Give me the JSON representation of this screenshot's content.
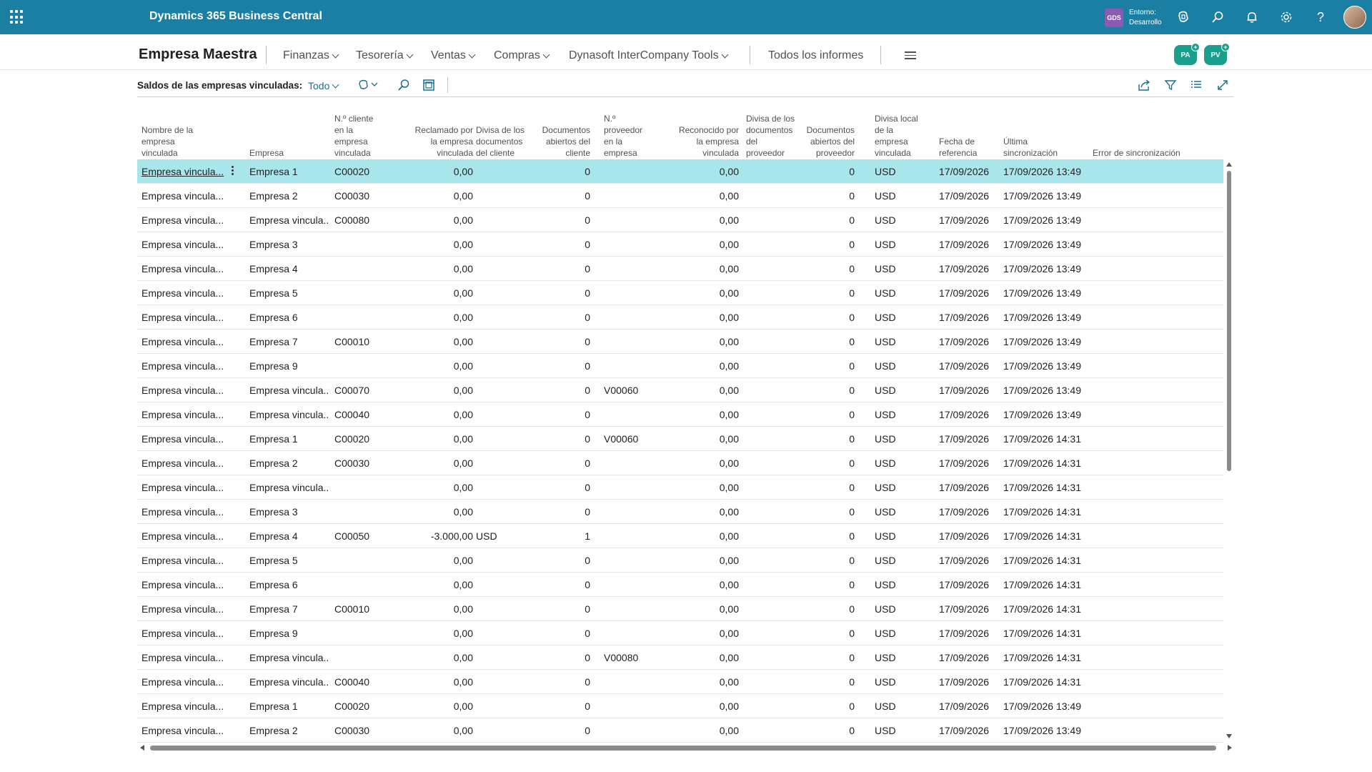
{
  "app": {
    "title": "Dynamics 365 Business Central"
  },
  "environment": {
    "badge": "GDS",
    "label": "Entorno:",
    "value": "Desarrollo"
  },
  "nav": {
    "company": "Empresa Maestra",
    "items": [
      {
        "label": "Finanzas"
      },
      {
        "label": "Tesorería"
      },
      {
        "label": "Ventas"
      },
      {
        "label": "Compras"
      },
      {
        "label": "Dynasoft InterCompany Tools"
      }
    ],
    "reports": "Todos los informes",
    "copilots": [
      {
        "label": "PA"
      },
      {
        "label": "PV"
      }
    ]
  },
  "part": {
    "title": "Saldos de las empresas vinculadas:",
    "filter": "Todo"
  },
  "columns": [
    [
      "Nombre de la",
      "empresa",
      "vinculada"
    ],
    [
      "Empresa"
    ],
    [
      "N.º cliente",
      "en la",
      "empresa",
      "vinculada"
    ],
    [
      "Reclamado por",
      "la empresa",
      "vinculada"
    ],
    [
      "Divisa de los",
      "documentos",
      "del cliente"
    ],
    [
      "Documentos",
      "abiertos del",
      "cliente"
    ],
    [
      "N.º",
      "proveedor",
      "en la",
      "empresa"
    ],
    [
      "Reconocido por",
      "la empresa",
      "vinculada"
    ],
    [
      "Divisa de los",
      "documentos",
      "del",
      "proveedor"
    ],
    [
      "Documentos",
      "abiertos del",
      "proveedor"
    ],
    [
      "Divisa local",
      "de la",
      "empresa",
      "vinculada"
    ],
    [
      "Fecha de",
      "referencia"
    ],
    [
      "Última",
      "sincronización"
    ],
    [
      "Error de sincronización"
    ]
  ],
  "rows": [
    [
      "Empresa vincula...",
      "Empresa 1",
      "C00020",
      "0,00",
      "",
      "0",
      "",
      "0,00",
      "",
      "0",
      "USD",
      "17/09/2026",
      "17/09/2026 13:49",
      ""
    ],
    [
      "Empresa vincula...",
      "Empresa 2",
      "C00030",
      "0,00",
      "",
      "0",
      "",
      "0,00",
      "",
      "0",
      "USD",
      "17/09/2026",
      "17/09/2026 13:49",
      ""
    ],
    [
      "Empresa vincula...",
      "Empresa vincula...",
      "C00080",
      "0,00",
      "",
      "0",
      "",
      "0,00",
      "",
      "0",
      "USD",
      "17/09/2026",
      "17/09/2026 13:49",
      ""
    ],
    [
      "Empresa vincula...",
      "Empresa 3",
      "",
      "0,00",
      "",
      "0",
      "",
      "0,00",
      "",
      "0",
      "USD",
      "17/09/2026",
      "17/09/2026 13:49",
      ""
    ],
    [
      "Empresa vincula...",
      "Empresa 4",
      "",
      "0,00",
      "",
      "0",
      "",
      "0,00",
      "",
      "0",
      "USD",
      "17/09/2026",
      "17/09/2026 13:49",
      ""
    ],
    [
      "Empresa vincula...",
      "Empresa 5",
      "",
      "0,00",
      "",
      "0",
      "",
      "0,00",
      "",
      "0",
      "USD",
      "17/09/2026",
      "17/09/2026 13:49",
      ""
    ],
    [
      "Empresa vincula...",
      "Empresa 6",
      "",
      "0,00",
      "",
      "0",
      "",
      "0,00",
      "",
      "0",
      "USD",
      "17/09/2026",
      "17/09/2026 13:49",
      ""
    ],
    [
      "Empresa vincula...",
      "Empresa 7",
      "C00010",
      "0,00",
      "",
      "0",
      "",
      "0,00",
      "",
      "0",
      "USD",
      "17/09/2026",
      "17/09/2026 13:49",
      ""
    ],
    [
      "Empresa vincula...",
      "Empresa 9",
      "",
      "0,00",
      "",
      "0",
      "",
      "0,00",
      "",
      "0",
      "USD",
      "17/09/2026",
      "17/09/2026 13:49",
      ""
    ],
    [
      "Empresa vincula...",
      "Empresa vincula...",
      "C00070",
      "0,00",
      "",
      "0",
      "V00060",
      "0,00",
      "",
      "0",
      "USD",
      "17/09/2026",
      "17/09/2026 13:49",
      ""
    ],
    [
      "Empresa vincula...",
      "Empresa vincula...",
      "C00040",
      "0,00",
      "",
      "0",
      "",
      "0,00",
      "",
      "0",
      "USD",
      "17/09/2026",
      "17/09/2026 13:49",
      ""
    ],
    [
      "Empresa vincula...",
      "Empresa 1",
      "C00020",
      "0,00",
      "",
      "0",
      "V00060",
      "0,00",
      "",
      "0",
      "USD",
      "17/09/2026",
      "17/09/2026 14:31",
      ""
    ],
    [
      "Empresa vincula...",
      "Empresa 2",
      "C00030",
      "0,00",
      "",
      "0",
      "",
      "0,00",
      "",
      "0",
      "USD",
      "17/09/2026",
      "17/09/2026 14:31",
      ""
    ],
    [
      "Empresa vincula...",
      "Empresa vincula...",
      "",
      "0,00",
      "",
      "0",
      "",
      "0,00",
      "",
      "0",
      "USD",
      "17/09/2026",
      "17/09/2026 14:31",
      ""
    ],
    [
      "Empresa vincula...",
      "Empresa 3",
      "",
      "0,00",
      "",
      "0",
      "",
      "0,00",
      "",
      "0",
      "USD",
      "17/09/2026",
      "17/09/2026 14:31",
      ""
    ],
    [
      "Empresa vincula...",
      "Empresa 4",
      "C00050",
      "-3.000,00",
      "USD",
      "1",
      "",
      "0,00",
      "",
      "0",
      "USD",
      "17/09/2026",
      "17/09/2026 14:31",
      ""
    ],
    [
      "Empresa vincula...",
      "Empresa 5",
      "",
      "0,00",
      "",
      "0",
      "",
      "0,00",
      "",
      "0",
      "USD",
      "17/09/2026",
      "17/09/2026 14:31",
      ""
    ],
    [
      "Empresa vincula...",
      "Empresa 6",
      "",
      "0,00",
      "",
      "0",
      "",
      "0,00",
      "",
      "0",
      "USD",
      "17/09/2026",
      "17/09/2026 14:31",
      ""
    ],
    [
      "Empresa vincula...",
      "Empresa 7",
      "C00010",
      "0,00",
      "",
      "0",
      "",
      "0,00",
      "",
      "0",
      "USD",
      "17/09/2026",
      "17/09/2026 14:31",
      ""
    ],
    [
      "Empresa vincula...",
      "Empresa 9",
      "",
      "0,00",
      "",
      "0",
      "",
      "0,00",
      "",
      "0",
      "USD",
      "17/09/2026",
      "17/09/2026 14:31",
      ""
    ],
    [
      "Empresa vincula...",
      "Empresa vincula...",
      "",
      "0,00",
      "",
      "0",
      "V00080",
      "0,00",
      "",
      "0",
      "USD",
      "17/09/2026",
      "17/09/2026 14:31",
      ""
    ],
    [
      "Empresa vincula...",
      "Empresa vincula...",
      "C00040",
      "0,00",
      "",
      "0",
      "",
      "0,00",
      "",
      "0",
      "USD",
      "17/09/2026",
      "17/09/2026 14:31",
      ""
    ],
    [
      "Empresa vincula...",
      "Empresa 1",
      "C00020",
      "0,00",
      "",
      "0",
      "",
      "0,00",
      "",
      "0",
      "USD",
      "17/09/2026",
      "17/09/2026 13:49",
      ""
    ],
    [
      "Empresa vincula...",
      "Empresa 2",
      "C00030",
      "0,00",
      "",
      "0",
      "",
      "0,00",
      "",
      "0",
      "USD",
      "17/09/2026",
      "17/09/2026 13:49",
      ""
    ]
  ],
  "colors": {
    "appbar": "#1b7fa3",
    "selection": "#a8e6ec",
    "link": "#1b6e8f",
    "copilot": "#1b9e8c"
  },
  "icons": [
    "app-launcher-icon",
    "copilot-icon",
    "search-icon",
    "bell-icon",
    "gear-icon",
    "help-icon",
    "share-icon",
    "filter-icon",
    "list-view-icon",
    "expand-icon",
    "find-icon",
    "edit-in-excel-icon"
  ]
}
